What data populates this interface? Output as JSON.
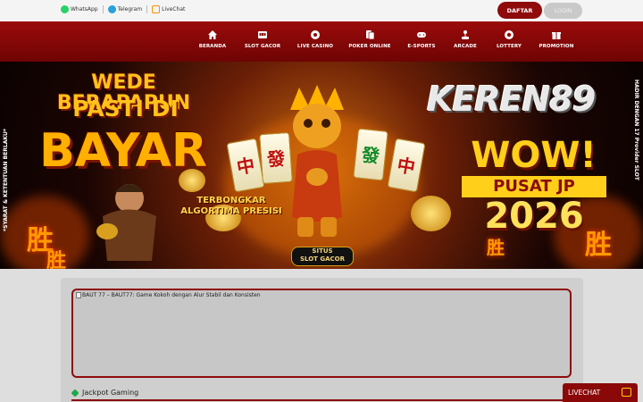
{
  "topbar": {
    "contacts": [
      {
        "label": "WhatsApp",
        "icon": "whatsapp-icon"
      },
      {
        "label": "Telegram",
        "icon": "telegram-icon"
      },
      {
        "label": "LiveChat",
        "icon": "livechat-icon"
      }
    ],
    "register_label": "DAFTAR",
    "login_label": "LOGIN"
  },
  "nav": {
    "items": [
      {
        "label": "BERANDA",
        "icon": "home-icon"
      },
      {
        "label": "SLOT GACOR",
        "icon": "slot-machine-icon"
      },
      {
        "label": "LIVE CASINO",
        "icon": "roulette-icon"
      },
      {
        "label": "POKER ONLINE",
        "icon": "cards-icon"
      },
      {
        "label": "E-SPORTS",
        "icon": "gamepad-icon"
      },
      {
        "label": "ARCADE",
        "icon": "joystick-icon"
      },
      {
        "label": "LOTTERY",
        "icon": "lottery-ball-icon"
      },
      {
        "label": "PROMOTION",
        "icon": "gift-icon"
      }
    ]
  },
  "banner": {
    "headline_1": "WEDE BERAPAPUN",
    "headline_2": "PASTI DI",
    "headline_3": "BAYAR",
    "brand": "KEREN89",
    "wow": "WOW!",
    "pusat": "PUSAT JP",
    "year": "2026",
    "strip_1": "TERBONGKAR",
    "strip_2": "ALGORTIMA PRESISI",
    "situs_1": "SITUS",
    "situs_2": "SLOT GACOR",
    "side_left": "*SYARAT & KETENTUAN BERLAKU*",
    "side_right": "HADIR DENGAN 17 Provider SLOT",
    "tile_chars": [
      "中",
      "發",
      "發",
      "中"
    ],
    "sheng": "胜"
  },
  "content": {
    "image_alt": "BAUT 77 – BAUT77: Game Kokoh dengan Alur Stabil dan Konsisten",
    "section_title": "Jackpot Gaming"
  },
  "livechat": {
    "label": "LIVECHAT"
  },
  "colors": {
    "primary": "#8f0b0b",
    "accent": "#ffc21a",
    "background": "#dedede"
  }
}
